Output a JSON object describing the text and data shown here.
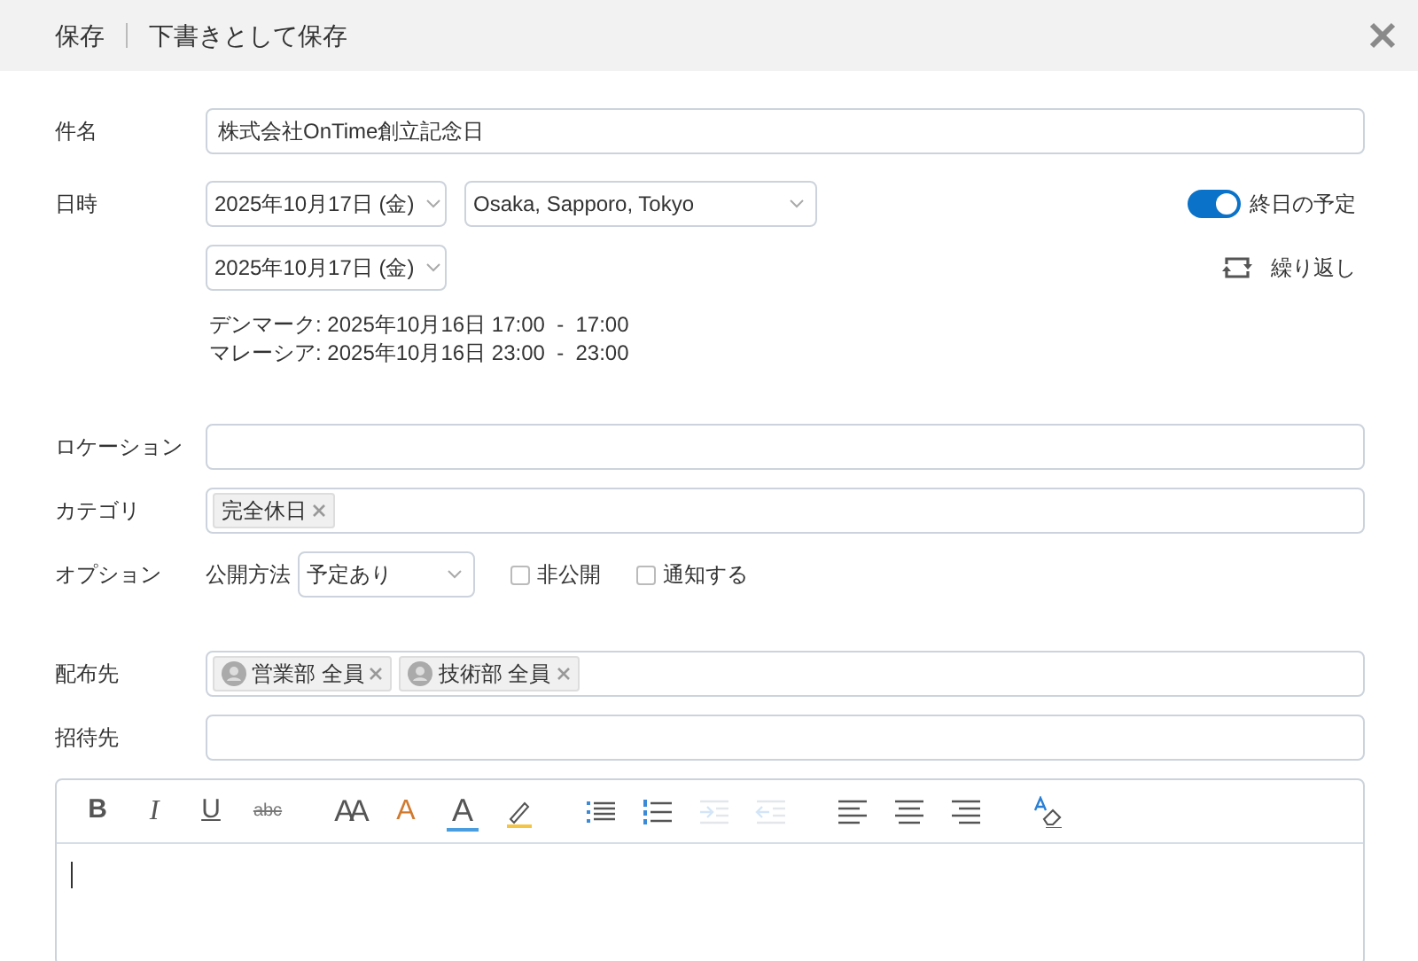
{
  "header": {
    "actions": [
      "保存",
      "下書きとして保存"
    ]
  },
  "subject": {
    "label": "件名",
    "value": "株式会社OnTime創立記念日"
  },
  "datetime": {
    "label": "日時",
    "start_date": "2025年10月17日 (金)",
    "timezone": "Osaka, Sapporo, Tokyo",
    "end_date": "2025年10月17日 (金)",
    "all_day": {
      "label": "終日の予定",
      "on": true
    },
    "repeat": {
      "label": "繰り返し"
    },
    "conversions": [
      "デンマーク: 2025年10月16日 17:00  -  17:00",
      "マレーシア: 2025年10月16日 23:00  -  23:00"
    ]
  },
  "location": {
    "label": "ロケーション"
  },
  "category": {
    "label": "カテゴリ",
    "tags": [
      "完全休日"
    ]
  },
  "options": {
    "label": "オプション",
    "visibility_label": "公開方法",
    "visibility": "予定あり",
    "checkboxes": [
      {
        "label": "非公開",
        "checked": false
      },
      {
        "label": "通知する",
        "checked": false
      }
    ]
  },
  "distribution": {
    "label": "配布先",
    "tags": [
      "営業部 全員",
      "技術部 全員"
    ]
  },
  "invitees": {
    "label": "招待先"
  },
  "editor": {
    "toolbar": [
      [
        {
          "kind": "text",
          "label": "B",
          "disabled": false
        },
        {
          "kind": "text",
          "label": "I",
          "disabled": false
        },
        {
          "kind": "text",
          "label": "U",
          "disabled": false
        },
        {
          "kind": "text",
          "label": "abc",
          "disabled": false
        }
      ],
      [
        {
          "kind": "text",
          "label": "AA",
          "disabled": false
        },
        {
          "kind": "text",
          "label": "A",
          "disabled": false
        },
        {
          "kind": "text",
          "label": "A",
          "disabled": false
        },
        {
          "kind": "icon",
          "disabled": false
        }
      ],
      [
        {
          "kind": "icon",
          "disabled": false
        },
        {
          "kind": "icon",
          "disabled": false
        },
        {
          "kind": "icon",
          "disabled": true
        },
        {
          "kind": "icon",
          "disabled": true
        }
      ],
      [
        {
          "kind": "icon",
          "disabled": false
        },
        {
          "kind": "icon",
          "disabled": false
        },
        {
          "kind": "icon",
          "disabled": false
        }
      ],
      [
        {
          "kind": "icon",
          "disabled": false
        }
      ]
    ]
  }
}
